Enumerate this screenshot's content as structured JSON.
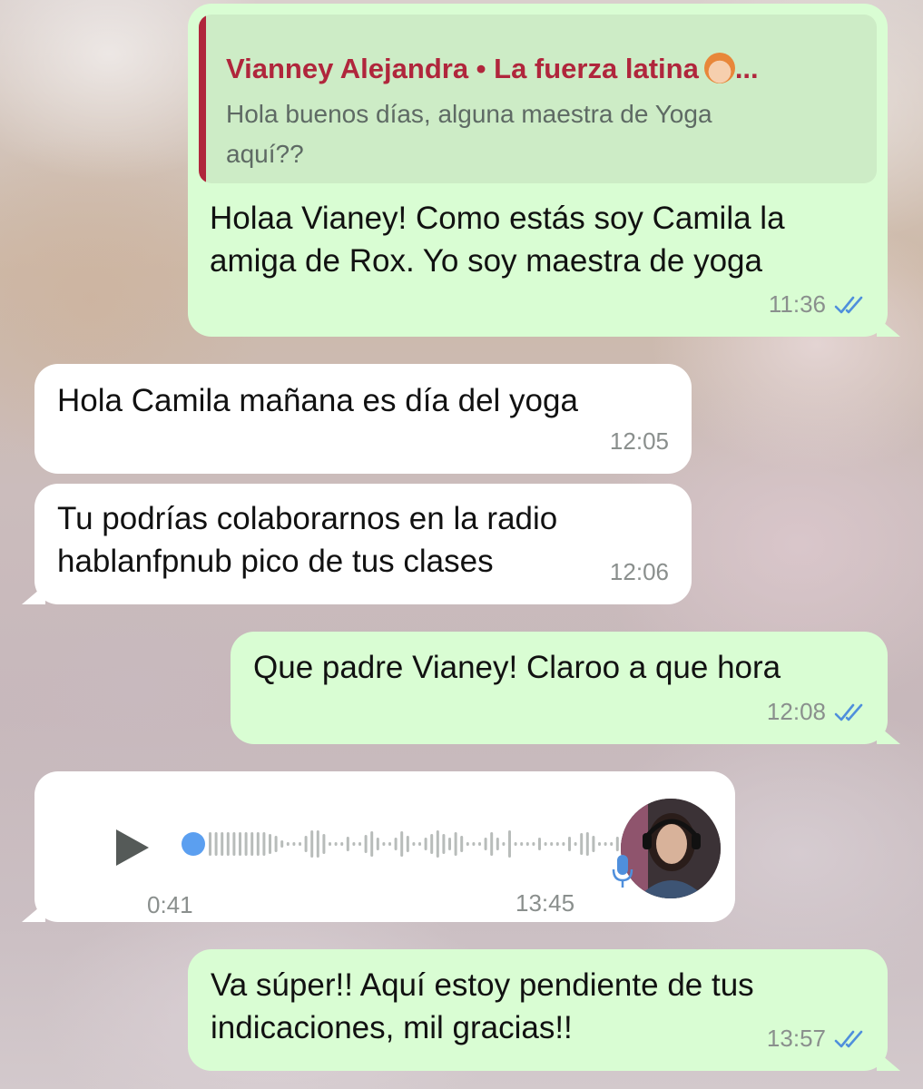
{
  "messages": [
    {
      "direction": "outgoing",
      "quote": {
        "author": "Vianney Alejandra • La fuerza latina",
        "author_suffix": "...",
        "author_emoji": "woman-red-hair-emoji",
        "text": "Hola buenos días, alguna maestra de Yoga\naquí??"
      },
      "text": "Holaa Vianey! Como estás soy Camila la\namiga de Rox. Yo soy maestra de yoga",
      "time": "11:36",
      "status": "read"
    },
    {
      "direction": "incoming",
      "text": "Hola Camila mañana es día del yoga",
      "time": "12:05"
    },
    {
      "direction": "incoming",
      "text": "Tu podrías colaborarnos en la radio\nhablanfpnub pico de tus clases",
      "time": "12:06"
    },
    {
      "direction": "outgoing",
      "text": "Que padre Vianey! Claroo a que hora",
      "time": "12:08",
      "status": "read"
    },
    {
      "direction": "incoming",
      "type": "voice",
      "duration": "0:41",
      "time": "13:45",
      "progress": 0
    },
    {
      "direction": "outgoing",
      "text": "Va súper!! Aquí estoy pendiente de tus\nindicaciones, mil gracias!!",
      "time": "13:57",
      "status": "read"
    }
  ],
  "colors": {
    "outgoing_bubble": "#d9fdd3",
    "incoming_bubble": "#ffffff",
    "quote_accent": "#b0263c",
    "read_ticks": "#4f8fdc",
    "audio_dot": "#5b9ff0"
  }
}
